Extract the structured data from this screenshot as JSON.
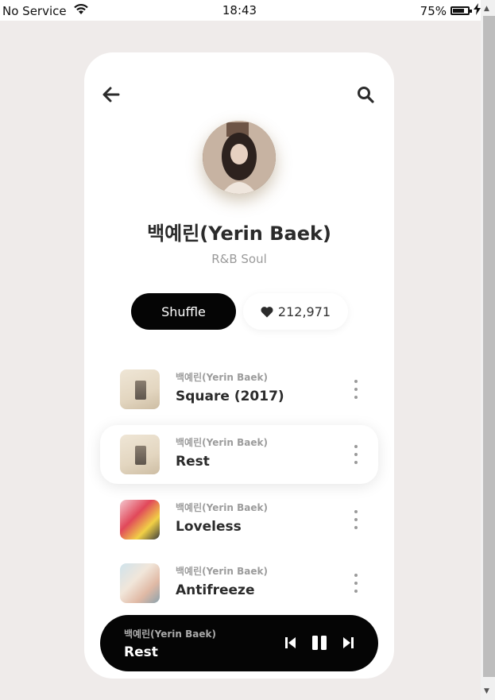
{
  "status_bar": {
    "carrier": "No Service",
    "time": "18:43",
    "battery": "75%"
  },
  "artist": {
    "name": "백예린(Yerin Baek)",
    "genre": "R&B Soul"
  },
  "actions": {
    "shuffle_label": "Shuffle",
    "likes": "212,971"
  },
  "tracks": [
    {
      "artist": "백예린(Yerin Baek)",
      "title": "Square (2017)"
    },
    {
      "artist": "백예린(Yerin Baek)",
      "title": "Rest"
    },
    {
      "artist": "백예린(Yerin Baek)",
      "title": "Loveless"
    },
    {
      "artist": "백예린(Yerin Baek)",
      "title": "Antifreeze"
    }
  ],
  "now_playing": {
    "artist": "백예린(Yerin Baek)",
    "title": "Rest"
  },
  "colors": {
    "background": "#efebea",
    "card": "#ffffff",
    "primary_button": "#050505",
    "player": "#050505",
    "muted_text": "#9c9c9c"
  },
  "icons": [
    "wifi-icon",
    "battery-icon",
    "charging-icon",
    "arrow-left-icon",
    "search-icon",
    "heart-icon",
    "more-vertical-icon",
    "skip-previous-icon",
    "pause-icon",
    "skip-next-icon"
  ]
}
